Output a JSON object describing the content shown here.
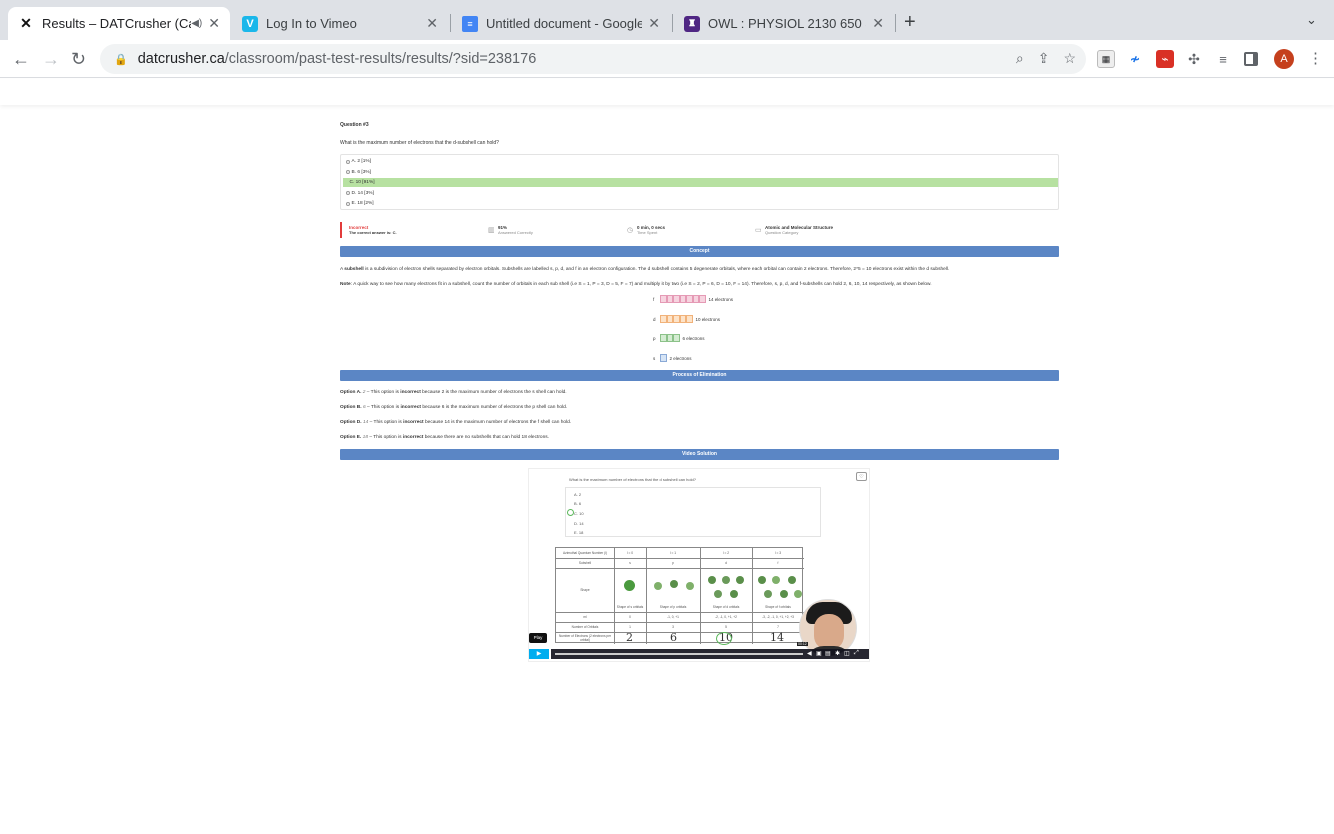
{
  "browser": {
    "tabs": [
      {
        "title": "Results – DATCrusher (Can",
        "icon": "datcrusher-favicon",
        "audio": "speaker-icon",
        "active": true
      },
      {
        "title": "Log In to Vimeo",
        "icon": "vimeo-favicon",
        "active": false
      },
      {
        "title": "Untitled document - Google Do",
        "icon": "google-docs-favicon",
        "active": false
      },
      {
        "title": "OWL : PHYSIOL 2130 650 SU2",
        "icon": "owl-favicon",
        "active": false
      }
    ],
    "url_host": "datcrusher.ca",
    "url_path": "/classroom/past-test-results/results/?sid=238176",
    "profile_initial": "A",
    "colors": {
      "profile": "#c5401d",
      "tabbar": "#dee1e6"
    }
  },
  "question": {
    "number": "Question #3",
    "text": "What is the maximum number of electrons that the d-subshell can hold?",
    "options": [
      "A. 2 [1%]",
      "B. 6 [3%]",
      "C. 10 [91%]",
      "D. 14 [3%]",
      "E. 18 [2%]"
    ],
    "correct_index": 2
  },
  "stats": {
    "result": "Incorrect",
    "correct_answer": "The correct answer is: C.",
    "percent": "91%",
    "percent_label": "Answered Correctly",
    "time": "0 min, 0 secs",
    "time_label": "Time Spent",
    "category": "Atomic and Molecular Structure",
    "category_label": "Question Category"
  },
  "concept": {
    "header": "Concept",
    "p1_pre": "A ",
    "p1_bold": "subshell",
    "p1_rest": " is a subdivision of electron shells separated by electron orbitals. Subshells are labelled s, p, d, and f in an electron configuration. The d subshell contains 5 degenerate orbitals, where each orbital can contain 2 electrons. Therefore, 2*5 = 10 electrons exist within the d subshell.",
    "p2_bold": "Note",
    "p2_rest": ": A quick way to see how many electrons fit in a subshell, count the number of orbitals in each sub shell (i.e S = 1, P = 3, D = 5, F = 7) and multiply it by two (i.e S = 2, P = 6, D = 10, F = 14). Therefore, s, p, d, and f-subshells can hold 2, 6, 10, 14 respectively, as shown below.",
    "orbitals": [
      {
        "label": "f",
        "boxes": 7,
        "text": "14 electrons",
        "fill": "#f6d3df",
        "border": "#e59ab5"
      },
      {
        "label": "d",
        "boxes": 5,
        "text": "10 electrons",
        "fill": "#fde3c8",
        "border": "#f1b27a"
      },
      {
        "label": "p",
        "boxes": 3,
        "text": "6 electrons",
        "fill": "#d4ecd2",
        "border": "#8cc289"
      },
      {
        "label": "s",
        "boxes": 1,
        "text": "2 electrons",
        "fill": "#d6e4f5",
        "border": "#8aa9d6"
      }
    ]
  },
  "elimination": {
    "header": "Process of Elimination",
    "items": [
      {
        "label": "Option A.",
        "value": "2",
        "text_pre": " – This option is ",
        "bold": "incorrect",
        "text_post": " because 2 is the maximum number of electrons the s shell can hold."
      },
      {
        "label": "Option B.",
        "value": "6",
        "text_pre": " – This option is ",
        "bold": "incorrect",
        "text_post": " because 6 is the maximum number of electrons the p shell can hold."
      },
      {
        "label": "Option D.",
        "value": "14",
        "text_pre": " – This option is ",
        "bold": "incorrect",
        "text_post": " because 14 is the maximum number of electrons the f shell can hold."
      },
      {
        "label": "Option E.",
        "value": "18",
        "text_pre": " – This option is ",
        "bold": "incorrect",
        "text_post": " because there are no subshells that can hold 18 electrons."
      }
    ]
  },
  "video": {
    "header": "Video Solution",
    "question": "What is the maximum number of electrons that the d subshell can hold?",
    "options": [
      "A. 2",
      "B. 6",
      "C. 10",
      "D. 14",
      "E. 18"
    ],
    "table_rows": [
      "Azimuthal Quantum Number (l)",
      "Subshell",
      "Shape",
      "ml",
      "Number of Orbitals",
      "Number of Electrons (2 electrons per orbital)"
    ],
    "l_values": [
      "l = 0",
      "l = 1",
      "l = 2",
      "l = 3"
    ],
    "subshells": [
      "s",
      "p",
      "d",
      "f"
    ],
    "shape_captions": [
      "Shape of s orbitals",
      "Shape of p orbitals",
      "Shape of d orbitals",
      "Shape of f orbitals"
    ],
    "ml_values": [
      "0",
      "-1, 0, +1",
      "-2, -1, 0, +1, +2",
      "-3, -2, -1, 0, +1, +2, +3"
    ],
    "orbital_counts": [
      "1",
      "3",
      "5",
      "7"
    ],
    "handwritten": [
      "2",
      "6",
      "10",
      "14"
    ],
    "play_tooltip": "Play",
    "timecode": "00:12"
  }
}
